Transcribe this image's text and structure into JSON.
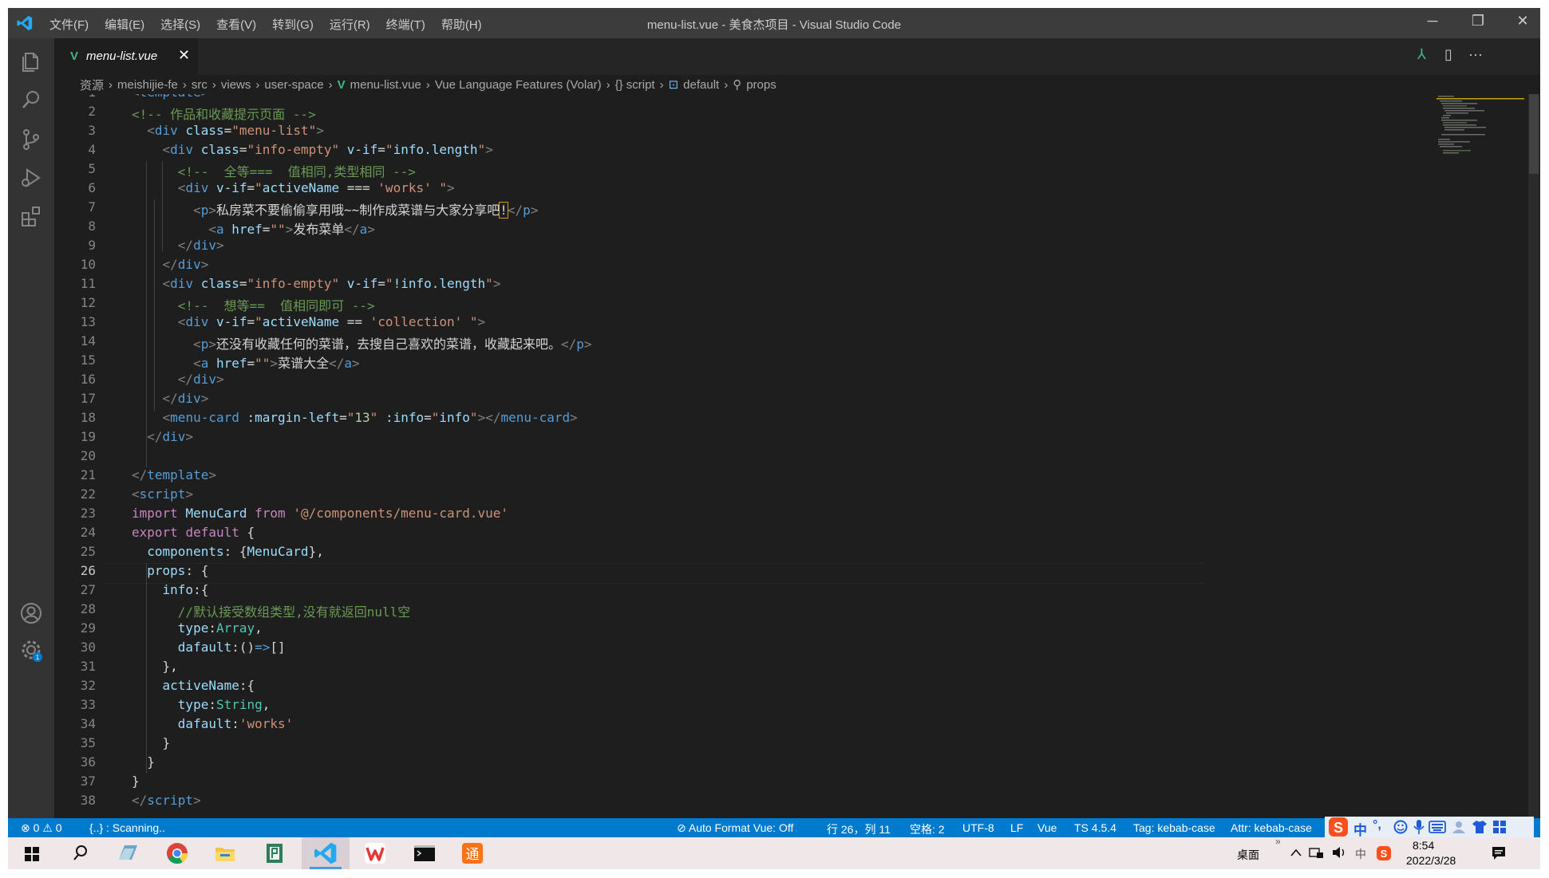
{
  "window": {
    "title": "menu-list.vue - 美食杰项目 - Visual Studio Code",
    "menu": [
      "文件(F)",
      "编辑(E)",
      "选择(S)",
      "查看(V)",
      "转到(G)",
      "运行(R)",
      "终端(T)",
      "帮助(H)"
    ],
    "controls": {
      "minimize": "─",
      "restore": "❐",
      "close": "✕"
    }
  },
  "tab": {
    "icon": "V",
    "name": "menu-list.vue",
    "close": "✕"
  },
  "tab_actions": {
    "branch": "⅄",
    "split": "▯",
    "more": "···"
  },
  "breadcrumb": {
    "items": [
      "资源",
      "meishijie-fe",
      "src",
      "views",
      "user-space"
    ],
    "file": "menu-list.vue",
    "volar": "Vue Language Features (Volar)",
    "script": "{} script",
    "default": "default",
    "props": "props"
  },
  "editor": {
    "lines": [
      [
        [
          "c-angle",
          "<"
        ],
        [
          "c-tag",
          "template"
        ],
        [
          "c-angle",
          ">"
        ]
      ],
      [
        [
          "c-com",
          "<!-- 作品和收藏提示页面 -->"
        ]
      ],
      [
        [
          "c-text",
          "  "
        ],
        [
          "c-angle",
          "<"
        ],
        [
          "c-tag",
          "div"
        ],
        [
          "c-text",
          " "
        ],
        [
          "c-attr",
          "class"
        ],
        [
          "c-text",
          "="
        ],
        [
          "c-str",
          "\"menu-list\""
        ],
        [
          "c-angle",
          ">"
        ]
      ],
      [
        [
          "c-text",
          "    "
        ],
        [
          "c-angle",
          "<"
        ],
        [
          "c-tag",
          "div"
        ],
        [
          "c-text",
          " "
        ],
        [
          "c-attr",
          "class"
        ],
        [
          "c-text",
          "="
        ],
        [
          "c-str",
          "\"info-empty\""
        ],
        [
          "c-text",
          " "
        ],
        [
          "c-attr",
          "v-if"
        ],
        [
          "c-text",
          "="
        ],
        [
          "c-str",
          "\""
        ],
        [
          "c-var",
          "info.length"
        ],
        [
          "c-str",
          "\""
        ],
        [
          "c-angle",
          ">"
        ]
      ],
      [
        [
          "c-text",
          "      "
        ],
        [
          "c-com",
          "<!--  全等===  值相同,类型相同 -->"
        ]
      ],
      [
        [
          "c-text",
          "      "
        ],
        [
          "c-angle",
          "<"
        ],
        [
          "c-tag",
          "div"
        ],
        [
          "c-text",
          " "
        ],
        [
          "c-attr",
          "v-if"
        ],
        [
          "c-text",
          "="
        ],
        [
          "c-str",
          "\""
        ],
        [
          "c-var",
          "activeName"
        ],
        [
          "c-text",
          " === "
        ],
        [
          "c-str",
          "'works'"
        ],
        [
          "c-text",
          " "
        ],
        [
          "c-str",
          "\""
        ],
        [
          "c-angle",
          ">"
        ]
      ],
      [
        [
          "c-text",
          "        "
        ],
        [
          "c-angle",
          "<"
        ],
        [
          "c-tag",
          "p"
        ],
        [
          "c-angle",
          ">"
        ],
        [
          "c-text",
          "私房菜不要偷偷享用哦~~制作成菜谱与大家分享吧"
        ],
        [
          "c-text hl",
          "!"
        ],
        [
          "c-angle",
          "</"
        ],
        [
          "c-tag",
          "p"
        ],
        [
          "c-angle",
          ">"
        ]
      ],
      [
        [
          "c-text",
          "          "
        ],
        [
          "c-angle",
          "<"
        ],
        [
          "c-tag",
          "a"
        ],
        [
          "c-text",
          " "
        ],
        [
          "c-attr",
          "href"
        ],
        [
          "c-text",
          "="
        ],
        [
          "c-str",
          "\"\""
        ],
        [
          "c-angle",
          ">"
        ],
        [
          "c-text",
          "发布菜单"
        ],
        [
          "c-angle",
          "</"
        ],
        [
          "c-tag",
          "a"
        ],
        [
          "c-angle",
          ">"
        ]
      ],
      [
        [
          "c-text",
          "      "
        ],
        [
          "c-angle",
          "</"
        ],
        [
          "c-tag",
          "div"
        ],
        [
          "c-angle",
          ">"
        ]
      ],
      [
        [
          "c-text",
          "    "
        ],
        [
          "c-angle",
          "</"
        ],
        [
          "c-tag",
          "div"
        ],
        [
          "c-angle",
          ">"
        ]
      ],
      [
        [
          "c-text",
          "    "
        ],
        [
          "c-angle",
          "<"
        ],
        [
          "c-tag",
          "div"
        ],
        [
          "c-text",
          " "
        ],
        [
          "c-attr",
          "class"
        ],
        [
          "c-text",
          "="
        ],
        [
          "c-str",
          "\"info-empty\""
        ],
        [
          "c-text",
          " "
        ],
        [
          "c-attr",
          "v-if"
        ],
        [
          "c-text",
          "="
        ],
        [
          "c-str",
          "\""
        ],
        [
          "c-var",
          "!info.length"
        ],
        [
          "c-str",
          "\""
        ],
        [
          "c-angle",
          ">"
        ]
      ],
      [
        [
          "c-text",
          "      "
        ],
        [
          "c-com",
          "<!--  想等==  值相同即可 -->"
        ]
      ],
      [
        [
          "c-text",
          "      "
        ],
        [
          "c-angle",
          "<"
        ],
        [
          "c-tag",
          "div"
        ],
        [
          "c-text",
          " "
        ],
        [
          "c-attr",
          "v-if"
        ],
        [
          "c-text",
          "="
        ],
        [
          "c-str",
          "\""
        ],
        [
          "c-var",
          "activeName"
        ],
        [
          "c-text",
          " == "
        ],
        [
          "c-str",
          "'collection'"
        ],
        [
          "c-text",
          " "
        ],
        [
          "c-str",
          "\""
        ],
        [
          "c-angle",
          ">"
        ]
      ],
      [
        [
          "c-text",
          "        "
        ],
        [
          "c-angle",
          "<"
        ],
        [
          "c-tag",
          "p"
        ],
        [
          "c-angle",
          ">"
        ],
        [
          "c-text",
          "还没有收藏任何的菜谱，去搜自己喜欢的菜谱，收藏起来吧。"
        ],
        [
          "c-angle",
          "</"
        ],
        [
          "c-tag",
          "p"
        ],
        [
          "c-angle",
          ">"
        ]
      ],
      [
        [
          "c-text",
          "        "
        ],
        [
          "c-angle",
          "<"
        ],
        [
          "c-tag",
          "a"
        ],
        [
          "c-text",
          " "
        ],
        [
          "c-attr",
          "href"
        ],
        [
          "c-text",
          "="
        ],
        [
          "c-str",
          "\"\""
        ],
        [
          "c-angle",
          ">"
        ],
        [
          "c-text",
          "菜谱大全"
        ],
        [
          "c-angle",
          "</"
        ],
        [
          "c-tag",
          "a"
        ],
        [
          "c-angle",
          ">"
        ]
      ],
      [
        [
          "c-text",
          "      "
        ],
        [
          "c-angle",
          "</"
        ],
        [
          "c-tag",
          "div"
        ],
        [
          "c-angle",
          ">"
        ]
      ],
      [
        [
          "c-text",
          "    "
        ],
        [
          "c-angle",
          "</"
        ],
        [
          "c-tag",
          "div"
        ],
        [
          "c-angle",
          ">"
        ]
      ],
      [
        [
          "c-text",
          "    "
        ],
        [
          "c-angle",
          "<"
        ],
        [
          "c-tag",
          "menu-card"
        ],
        [
          "c-text",
          " "
        ],
        [
          "c-attr",
          ":margin-left"
        ],
        [
          "c-text",
          "="
        ],
        [
          "c-str",
          "\""
        ],
        [
          "c-num",
          "13"
        ],
        [
          "c-str",
          "\""
        ],
        [
          "c-text",
          " "
        ],
        [
          "c-attr",
          ":info"
        ],
        [
          "c-text",
          "="
        ],
        [
          "c-str",
          "\""
        ],
        [
          "c-var",
          "info"
        ],
        [
          "c-str",
          "\""
        ],
        [
          "c-angle",
          "></"
        ],
        [
          "c-tag",
          "menu-card"
        ],
        [
          "c-angle",
          ">"
        ]
      ],
      [
        [
          "c-text",
          "  "
        ],
        [
          "c-angle",
          "</"
        ],
        [
          "c-tag",
          "div"
        ],
        [
          "c-angle",
          ">"
        ]
      ],
      [
        [
          "c-text",
          ""
        ]
      ],
      [
        [
          "c-angle",
          "</"
        ],
        [
          "c-tag",
          "template"
        ],
        [
          "c-angle",
          ">"
        ]
      ],
      [
        [
          "c-angle",
          "<"
        ],
        [
          "c-tag",
          "script"
        ],
        [
          "c-angle",
          ">"
        ]
      ],
      [
        [
          "c-kw",
          "import"
        ],
        [
          "c-text",
          " "
        ],
        [
          "c-var",
          "MenuCard"
        ],
        [
          "c-text",
          " "
        ],
        [
          "c-kw",
          "from"
        ],
        [
          "c-text",
          " "
        ],
        [
          "c-str",
          "'@/components/menu-card.vue'"
        ]
      ],
      [
        [
          "c-kw",
          "export"
        ],
        [
          "c-text",
          " "
        ],
        [
          "c-kw",
          "default"
        ],
        [
          "c-text",
          " {"
        ]
      ],
      [
        [
          "c-text",
          "  "
        ],
        [
          "c-var",
          "components"
        ],
        [
          "c-text",
          ": {"
        ],
        [
          "c-var",
          "MenuCard"
        ],
        [
          "c-text",
          "},"
        ]
      ],
      [
        [
          "c-text",
          "  "
        ],
        [
          "c-var",
          "props"
        ],
        [
          "c-text",
          ": {"
        ]
      ],
      [
        [
          "c-text",
          "    "
        ],
        [
          "c-var",
          "info"
        ],
        [
          "c-text",
          ":{"
        ]
      ],
      [
        [
          "c-text",
          "      "
        ],
        [
          "c-com",
          "//默认接受数组类型,没有就返回null空"
        ]
      ],
      [
        [
          "c-text",
          "      "
        ],
        [
          "c-var",
          "type"
        ],
        [
          "c-text",
          ":"
        ],
        [
          "c-type",
          "Array"
        ],
        [
          "c-text",
          ","
        ]
      ],
      [
        [
          "c-text",
          "      "
        ],
        [
          "c-var",
          "dafault"
        ],
        [
          "c-text",
          ":()"
        ],
        [
          "c-kw2",
          "=>"
        ],
        [
          "c-text",
          "[]"
        ]
      ],
      [
        [
          "c-text",
          "    },"
        ]
      ],
      [
        [
          "c-text",
          "    "
        ],
        [
          "c-var",
          "activeName"
        ],
        [
          "c-text",
          ":{"
        ]
      ],
      [
        [
          "c-text",
          "      "
        ],
        [
          "c-var",
          "type"
        ],
        [
          "c-text",
          ":"
        ],
        [
          "c-type",
          "String"
        ],
        [
          "c-text",
          ","
        ]
      ],
      [
        [
          "c-text",
          "      "
        ],
        [
          "c-var",
          "dafault"
        ],
        [
          "c-text",
          ":"
        ],
        [
          "c-str",
          "'works'"
        ]
      ],
      [
        [
          "c-text",
          "    }"
        ]
      ],
      [
        [
          "c-text",
          "  }"
        ]
      ],
      [
        [
          "c-text",
          "}"
        ]
      ],
      [
        [
          "c-angle",
          "</"
        ],
        [
          "c-tag",
          "script"
        ],
        [
          "c-angle",
          ">"
        ]
      ]
    ],
    "active_line": 26
  },
  "status": {
    "errors": "⊗ 0 ⚠ 0",
    "scanning": "{..} : Scanning..",
    "auto_format": "Auto Format Vue: Off",
    "position": "行 26，列 11",
    "spaces": "空格: 2",
    "encoding": "UTF-8",
    "eol": "LF",
    "language": "Vue",
    "ts": "TS 4.5.4",
    "tag": "Tag: kebab-case",
    "attr": "Attr: kebab-case"
  },
  "ime": {
    "lang": "中",
    "punct": "°,"
  },
  "taskbar": {
    "desktop": "桌面",
    "time": "8:54",
    "date": "2022/3/28",
    "tray_lang": "中",
    "chevron": "»"
  },
  "colors": {
    "accent": "#007acc",
    "vue": "#41b883",
    "editor_bg": "#1e1e1e"
  }
}
